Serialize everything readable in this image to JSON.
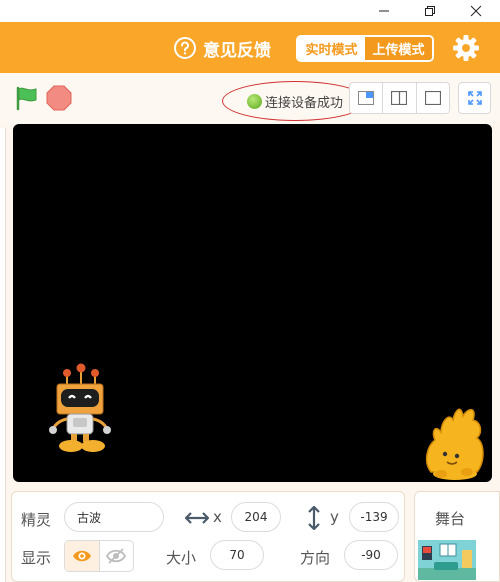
{
  "window": {
    "minimize": "minimize",
    "restore": "restore",
    "close": "close"
  },
  "menubar": {
    "feedback_label": "意见反馈",
    "modes": [
      {
        "label": "实时模式",
        "active": true
      },
      {
        "label": "上传模式",
        "active": false
      }
    ],
    "settings_icon": "gear-icon"
  },
  "toolbar": {
    "connection_status": "连接设备成功",
    "icons": [
      "green-flag-icon",
      "stop-icon",
      "small-stage-icon",
      "large-stage-icon",
      "stage-only-icon",
      "fullscreen-icon"
    ]
  },
  "sprite": {
    "sprite_label": "精灵",
    "name": "古波",
    "x_label": "x",
    "x": "204",
    "y_label": "y",
    "y": "-139",
    "show_label": "显示",
    "size_label": "大小",
    "size": "70",
    "direction_label": "方向",
    "direction": "-90"
  },
  "stage_panel": {
    "label": "舞台"
  },
  "colors": {
    "accent": "#f9a629",
    "accent_dark": "#f39a1e",
    "stage_bg": "#000000",
    "connected": "#6fbf2a"
  }
}
